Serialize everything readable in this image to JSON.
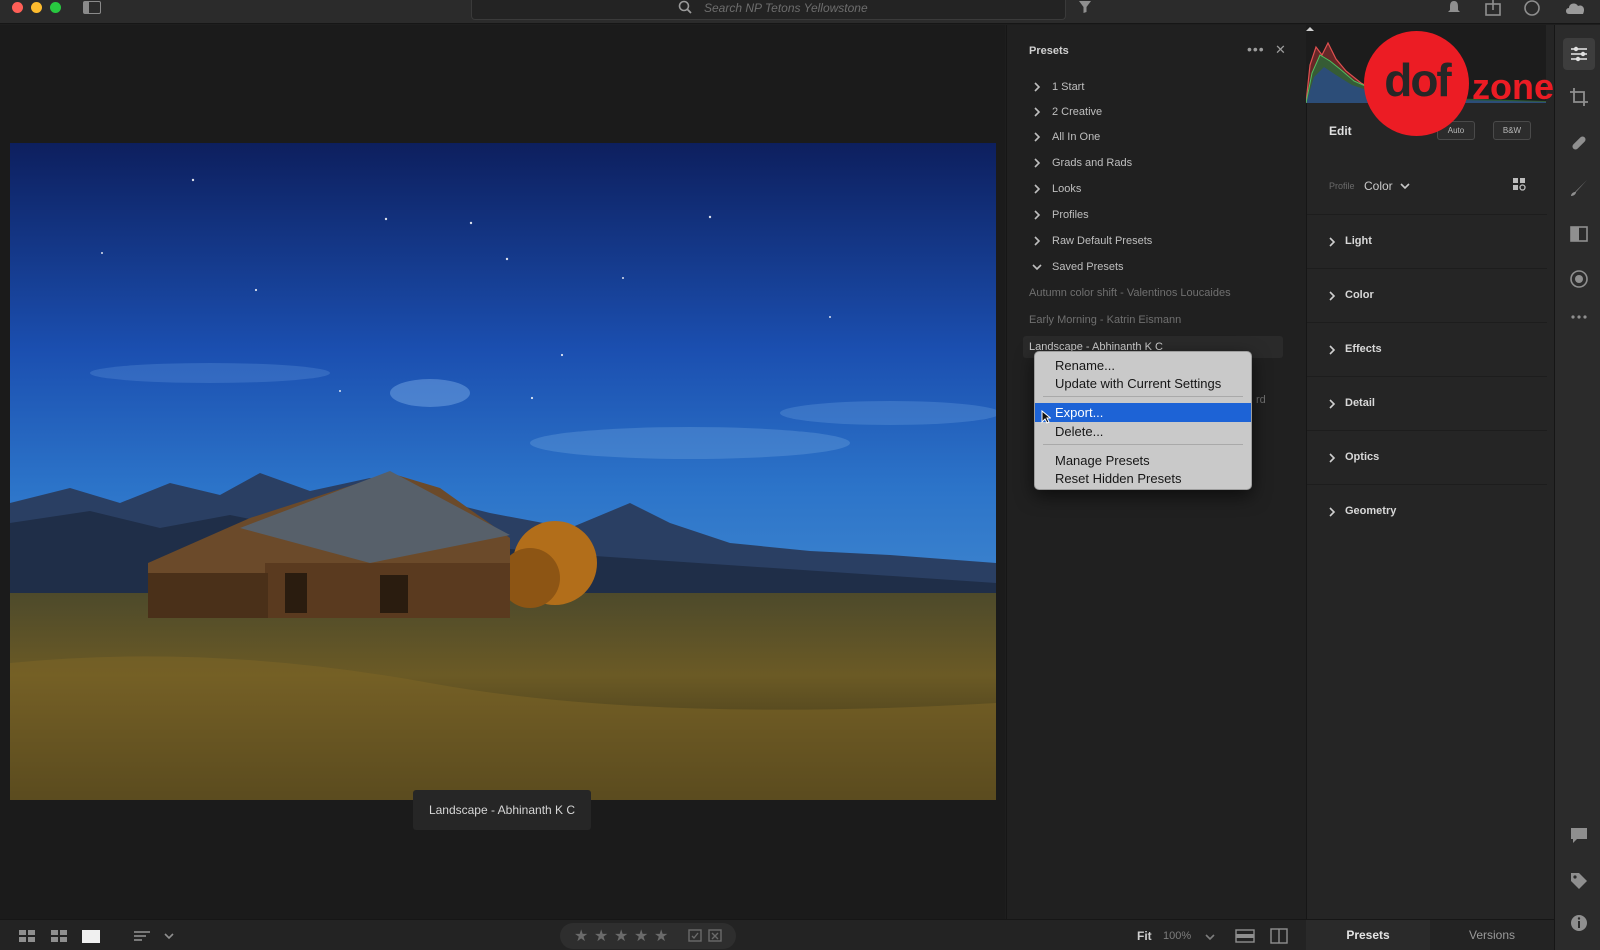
{
  "topbar": {
    "search_placeholder": "Search NP Tetons Yellowstone",
    "icons": [
      "sidebar-toggle-icon",
      "search-icon",
      "filter-icon",
      "notifications-icon",
      "share-icon",
      "help-icon",
      "cloud-icon"
    ]
  },
  "photo": {
    "caption": "Landscape - Abhinanth K C"
  },
  "presets_panel": {
    "title": "Presets",
    "groups": [
      {
        "label": "1 Start",
        "expanded": false
      },
      {
        "label": "2 Creative",
        "expanded": false
      },
      {
        "label": "All In One",
        "expanded": false
      },
      {
        "label": "Grads and Rads",
        "expanded": false
      },
      {
        "label": "Looks",
        "expanded": false
      },
      {
        "label": "Profiles",
        "expanded": false
      },
      {
        "label": "Raw Default Presets",
        "expanded": false
      },
      {
        "label": "Saved Presets",
        "expanded": true
      }
    ],
    "saved_items": [
      "Autumn color shift - Valentinos Loucaides",
      "Early Morning - Katrin Eismann",
      "Landscape - Abhinanth K C"
    ],
    "peek_right": "rd"
  },
  "context_menu": {
    "items": [
      {
        "label": "Rename...",
        "highlighted": false
      },
      {
        "label": "Update with Current Settings",
        "highlighted": false
      },
      {
        "label": "Export...",
        "highlighted": true
      },
      {
        "label": "Delete...",
        "highlighted": false
      },
      {
        "label": "Manage Presets",
        "highlighted": false
      },
      {
        "label": "Reset Hidden Presets",
        "highlighted": false
      }
    ]
  },
  "edit_panel": {
    "title": "Edit",
    "auto_label": "Auto",
    "bw_label": "B&W",
    "profile_label": "Profile",
    "profile_value": "Color",
    "sections": [
      "Light",
      "Color",
      "Effects",
      "Detail",
      "Optics",
      "Geometry"
    ]
  },
  "logo": {
    "part1": "dof",
    "part2": "zone",
    "color": "#ec1c24"
  },
  "bottombar": {
    "stars": [
      "★",
      "★",
      "★",
      "★",
      "★"
    ],
    "fit_label": "Fit",
    "zoom_label": "100%"
  },
  "right_panel_tabs": {
    "presets_label": "Presets",
    "versions_label": "Versions"
  },
  "colors": {
    "accent": "#1d63d6",
    "panel_bg": "#202020",
    "menu_bg": "#c9c9c9"
  }
}
